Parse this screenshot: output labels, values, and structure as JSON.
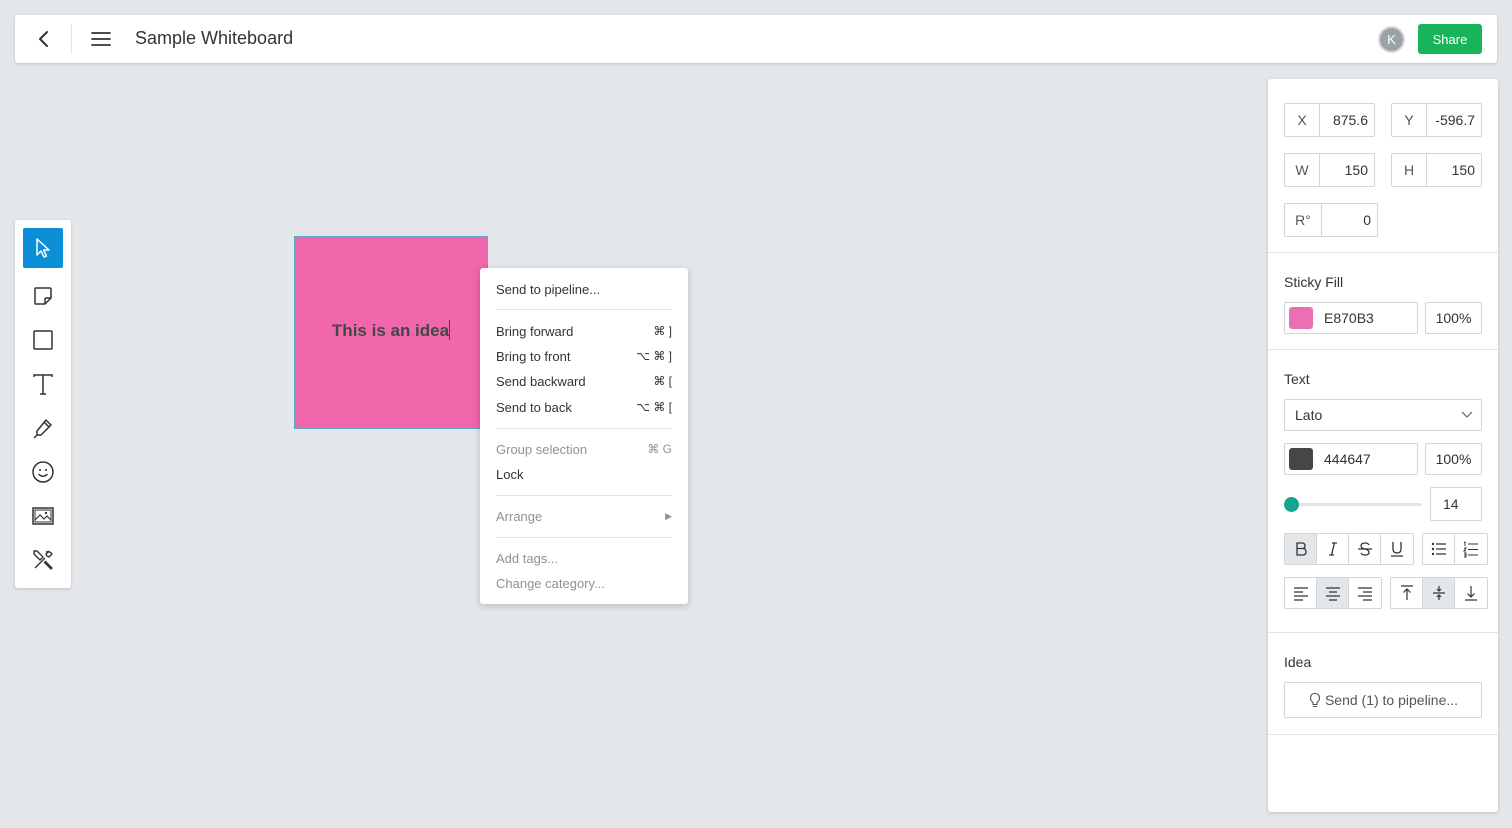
{
  "header": {
    "title": "Sample Whiteboard",
    "avatar_initial": "K",
    "share_label": "Share"
  },
  "toolbar": {
    "tools": [
      "select-icon",
      "sticky-note-icon",
      "rectangle-icon",
      "text-icon",
      "pen-icon",
      "emoji-icon",
      "image-icon",
      "tools-icon"
    ],
    "active_tool": "select",
    "accent_color": "#0b8fd6"
  },
  "sticky": {
    "text": "This is an idea",
    "fill": "#f067ab"
  },
  "context_menu": {
    "send_to_pipeline": "Send to pipeline...",
    "bring_forward": {
      "label": "Bring forward",
      "shortcut": "⌘ ]"
    },
    "bring_to_front": {
      "label": "Bring to front",
      "shortcut": "⌥ ⌘ ]"
    },
    "send_backward": {
      "label": "Send backward",
      "shortcut": "⌘ ["
    },
    "send_to_back": {
      "label": "Send to back",
      "shortcut": "⌥ ⌘ ["
    },
    "group_selection": {
      "label": "Group selection",
      "shortcut": "⌘ G"
    },
    "lock": "Lock",
    "arrange": "Arrange",
    "add_tags": "Add tags...",
    "change_category": "Change category..."
  },
  "properties": {
    "x": {
      "label": "X",
      "value": "875.6"
    },
    "y": {
      "label": "Y",
      "value": "-596.7"
    },
    "w": {
      "label": "W",
      "value": "150"
    },
    "h": {
      "label": "H",
      "value": "150"
    },
    "r": {
      "label": "R°",
      "value": "0"
    },
    "sticky_fill": {
      "title": "Sticky Fill",
      "hex": "E870B3",
      "swatch": "#e870b3",
      "opacity": "100%"
    },
    "text": {
      "title": "Text",
      "font": "Lato",
      "hex": "444647",
      "swatch": "#444647",
      "opacity": "100%",
      "size": "14",
      "bold": true,
      "align": "center",
      "valign": "middle"
    },
    "idea": {
      "title": "Idea",
      "send_label": "Send (1) to pipeline..."
    }
  },
  "colors": {
    "share": "#18b45a",
    "slider": "#14a58c"
  }
}
